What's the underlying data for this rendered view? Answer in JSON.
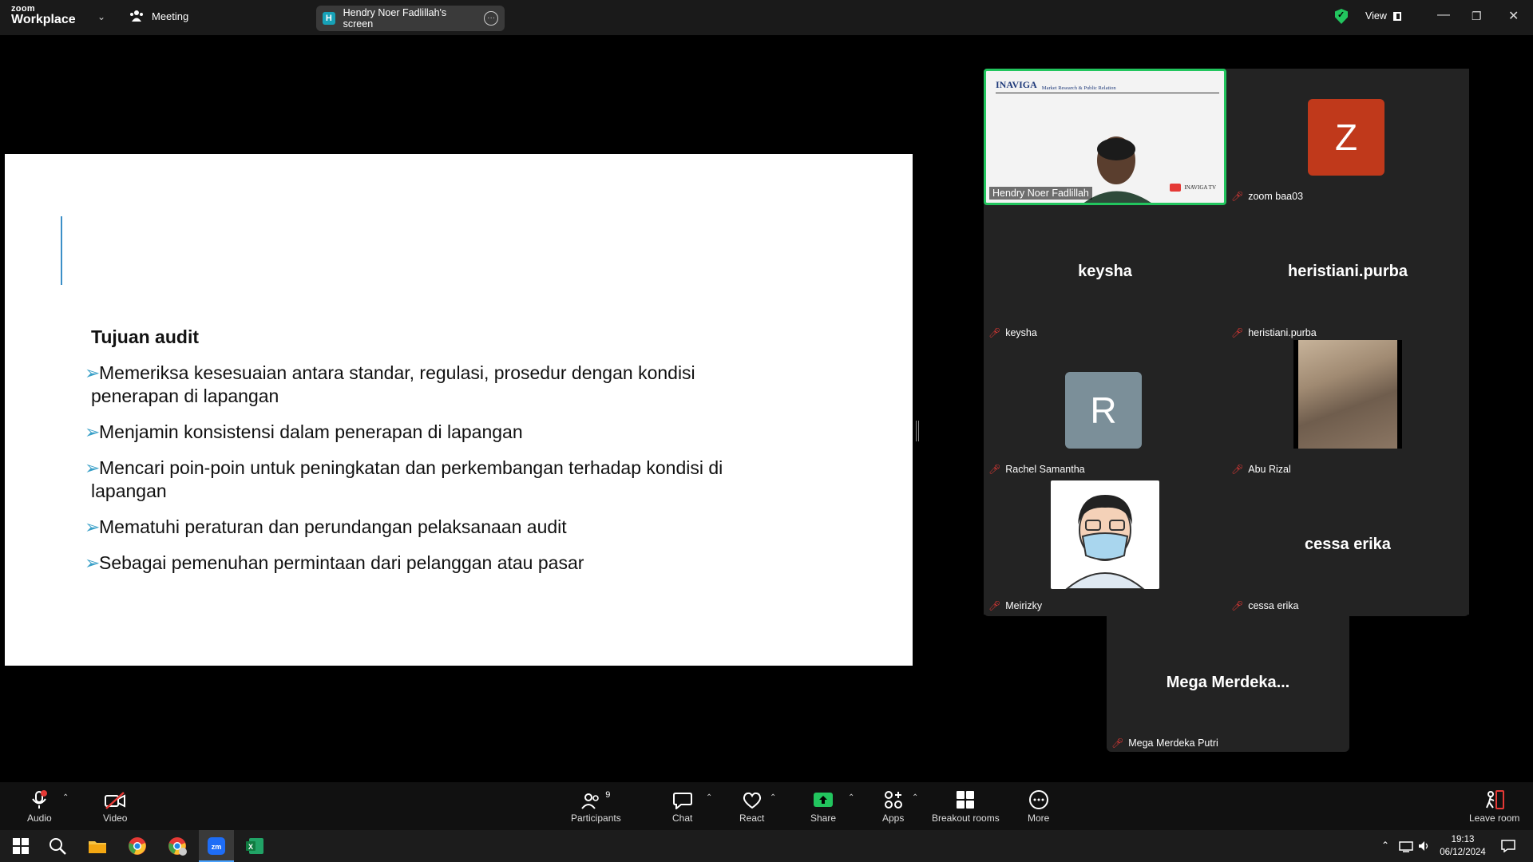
{
  "titlebar": {
    "logo_top": "zoom",
    "logo_bottom": "Workplace",
    "meeting_label": "Meeting",
    "screen_share_initial": "H",
    "screen_share_label": "Hendry Noer Fadlillah's screen",
    "view_label": "View"
  },
  "slide": {
    "heading": "Tujuan audit",
    "bullets": [
      "Memeriksa kesesuaian antara standar, regulasi, prosedur dengan kondisi penerapan di lapangan",
      "Menjamin konsistensi dalam penerapan di lapangan",
      "Mencari poin-poin untuk peningkatan dan perkembangan terhadap kondisi di lapangan",
      "Mematuhi peraturan dan perundangan pelaksanaan audit",
      "Sebagai pemenuhan permintaan dari pelanggan atau pasar"
    ]
  },
  "gallery": {
    "video_tile": {
      "name": "Hendry Noer Fadlillah",
      "banner_logo": "INAVIGA",
      "banner_text": "Market Research & Public Relation",
      "tv_label": "INAVIGA TV"
    },
    "tiles": [
      {
        "name": "zoom baa03",
        "avatar_letter": "Z",
        "avatar_color": "#c0391b"
      },
      {
        "name": "keysha",
        "center_name": "keysha"
      },
      {
        "name": "heristiani.purba",
        "center_name": "heristiani.purba"
      },
      {
        "name": "Rachel Samantha",
        "avatar_letter": "R",
        "avatar_color": "#7b8f99"
      },
      {
        "name": "Abu Rizal"
      },
      {
        "name": "Meirizky"
      },
      {
        "name": "cessa erika",
        "center_name": "cessa erika"
      },
      {
        "name": "Mega Merdeka Putri",
        "center_name": "Mega  Merdeka..."
      }
    ]
  },
  "toolbar": {
    "audio": "Audio",
    "video": "Video",
    "participants": "Participants",
    "participants_count": "9",
    "chat": "Chat",
    "react": "React",
    "share": "Share",
    "apps": "Apps",
    "breakout": "Breakout rooms",
    "more": "More",
    "leave": "Leave room",
    "share_color": "#22c55e",
    "mute_color": "#e53935"
  },
  "taskbar": {
    "time": "19:13",
    "date": "06/12/2024"
  }
}
